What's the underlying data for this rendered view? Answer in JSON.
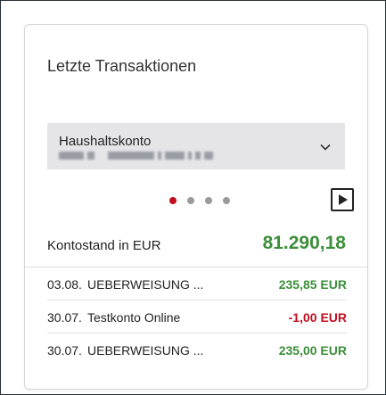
{
  "widget": {
    "title": "Letzte Transaktionen"
  },
  "account": {
    "name": "Haushaltskonto",
    "number_obscured": true,
    "dropdown_icon": "chevron-down-icon"
  },
  "carousel": {
    "page_count": 4,
    "active_page": 1,
    "next_icon": "play-arrow-icon"
  },
  "balance": {
    "label": "Kontostand in EUR",
    "value": "81.290,18"
  },
  "transactions": [
    {
      "date": "03.08.",
      "description": "UEBERWEISUNG ...",
      "amount": "235,85 EUR",
      "sign": "positive"
    },
    {
      "date": "30.07.",
      "description": "Testkonto Online",
      "amount": "-1,00 EUR",
      "sign": "negative"
    },
    {
      "date": "30.07.",
      "description": "UEBERWEISUNG ...",
      "amount": "235,00 EUR",
      "sign": "positive"
    }
  ],
  "colors": {
    "positive": "#3b8f39",
    "negative": "#c00d1e",
    "active_dot": "#c00d1e",
    "inactive_dot": "#9a9a9a",
    "select_background": "#e5e5e8"
  }
}
